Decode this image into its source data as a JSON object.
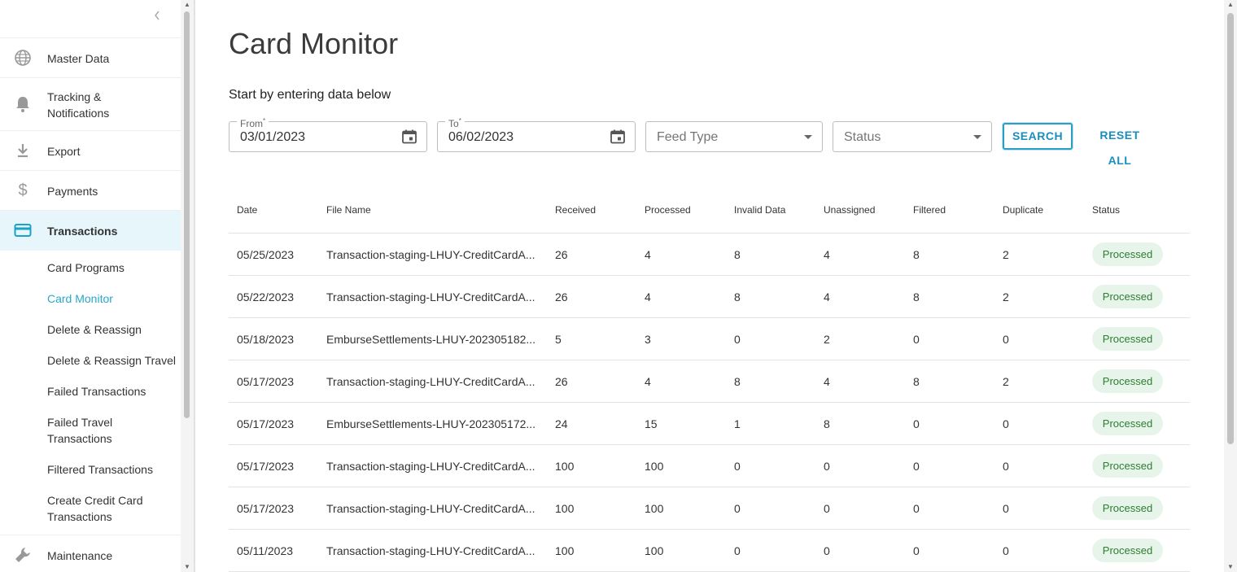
{
  "sidebar": {
    "items": [
      {
        "label": "Master Data",
        "icon": "globe-icon"
      },
      {
        "label": "Tracking & Notifications",
        "icon": "bell-icon"
      },
      {
        "label": "Export",
        "icon": "download-icon"
      },
      {
        "label": "Payments",
        "icon": "dollar-icon"
      },
      {
        "label": "Transactions",
        "icon": "credit-card-icon"
      },
      {
        "label": "Maintenance",
        "icon": "wrench-icon"
      }
    ],
    "tracking_line1": "Tracking &",
    "tracking_line2": "Notifications",
    "subitems": [
      "Card Programs",
      "Card Monitor",
      "Delete & Reassign",
      "Delete & Reassign Travel",
      "Failed Transactions",
      "Failed Travel",
      "Transactions",
      "Filtered Transactions",
      "Create Credit Card",
      "Transactions"
    ],
    "active_color": "#26a9c9"
  },
  "page": {
    "title": "Card Monitor",
    "subtitle": "Start by entering data below"
  },
  "filters": {
    "from_label": "From",
    "from_value": "03/01/2023",
    "to_label": "To",
    "to_value": "06/02/2023",
    "feed_type_placeholder": "Feed Type",
    "status_placeholder": "Status",
    "search_label": "SEARCH",
    "reset_label": "RESET ALL"
  },
  "table": {
    "columns": [
      "Date",
      "File Name",
      "Received",
      "Processed",
      "Invalid Data",
      "Unassigned",
      "Filtered",
      "Duplicate",
      "Status"
    ],
    "rows": [
      [
        "05/25/2023",
        "Transaction-staging-LHUY-CreditCardA...",
        "26",
        "4",
        "8",
        "4",
        "8",
        "2",
        "Processed"
      ],
      [
        "05/22/2023",
        "Transaction-staging-LHUY-CreditCardA...",
        "26",
        "4",
        "8",
        "4",
        "8",
        "2",
        "Processed"
      ],
      [
        "05/18/2023",
        "EmburseSettlements-LHUY-202305182...",
        "5",
        "3",
        "0",
        "2",
        "0",
        "0",
        "Processed"
      ],
      [
        "05/17/2023",
        "Transaction-staging-LHUY-CreditCardA...",
        "26",
        "4",
        "8",
        "4",
        "8",
        "2",
        "Processed"
      ],
      [
        "05/17/2023",
        "EmburseSettlements-LHUY-202305172...",
        "24",
        "15",
        "1",
        "8",
        "0",
        "0",
        "Processed"
      ],
      [
        "05/17/2023",
        "Transaction-staging-LHUY-CreditCardA...",
        "100",
        "100",
        "0",
        "0",
        "0",
        "0",
        "Processed"
      ],
      [
        "05/17/2023",
        "Transaction-staging-LHUY-CreditCardA...",
        "100",
        "100",
        "0",
        "0",
        "0",
        "0",
        "Processed"
      ],
      [
        "05/11/2023",
        "Transaction-staging-LHUY-CreditCardA...",
        "100",
        "100",
        "0",
        "0",
        "0",
        "0",
        "Processed"
      ]
    ],
    "status_color": "#2e7d32"
  }
}
